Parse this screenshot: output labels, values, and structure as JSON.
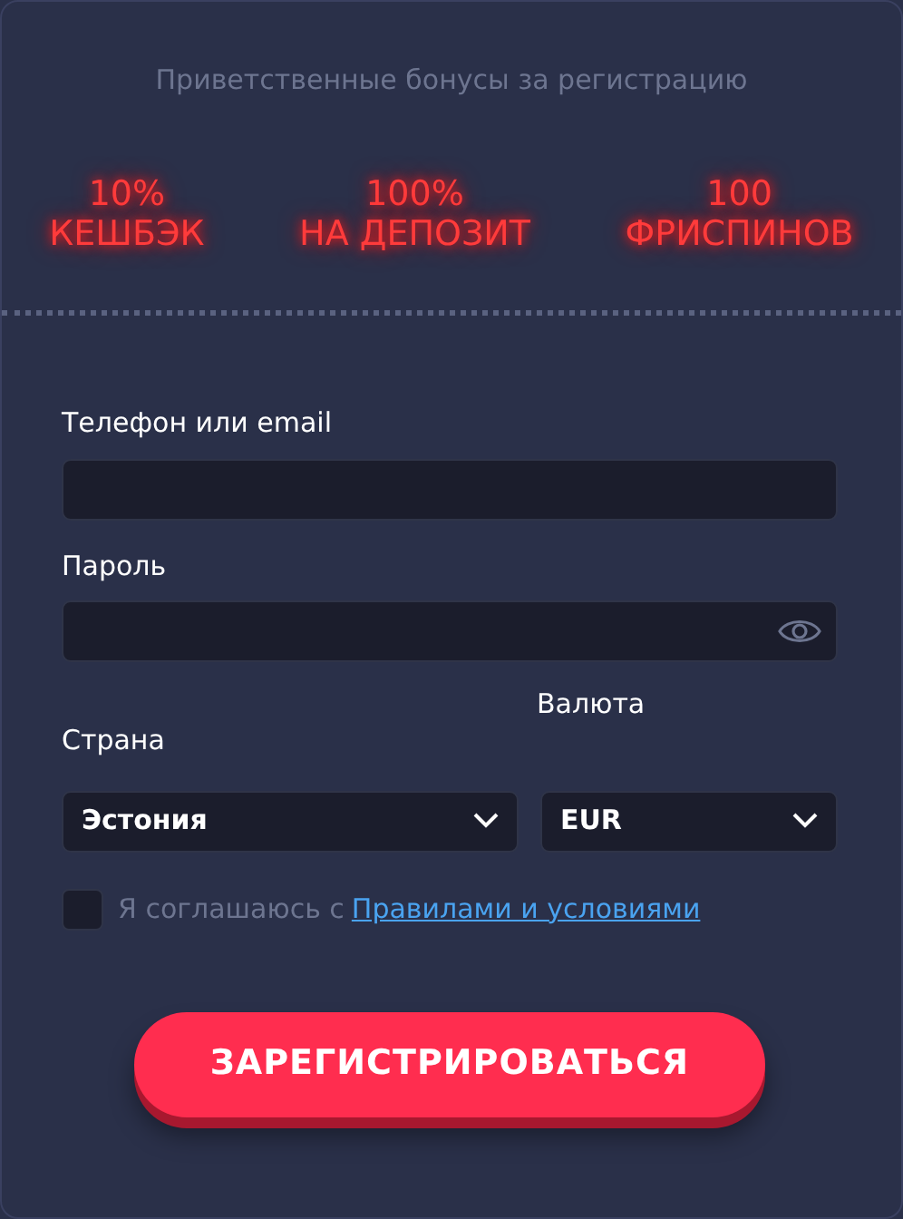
{
  "heading": "Приветственные бонусы за регистрацию",
  "bonuses": [
    {
      "amount": "10%",
      "label": "КЕШБЭК"
    },
    {
      "amount": "100%",
      "label": "НА ДЕПОЗИТ"
    },
    {
      "amount": "100",
      "label": "ФРИСПИНОВ"
    }
  ],
  "login": {
    "label": "Телефон или email"
  },
  "password": {
    "label": "Пароль"
  },
  "currency": {
    "label": "Валюта",
    "value": "EUR"
  },
  "country": {
    "label": "Страна",
    "value": "Эстония"
  },
  "agree": {
    "checked": false,
    "text": "Я соглашаюсь с",
    "link": "Правилами и условиями"
  },
  "submit": "ЗАРЕГИСТРИРОВАТЬСЯ"
}
